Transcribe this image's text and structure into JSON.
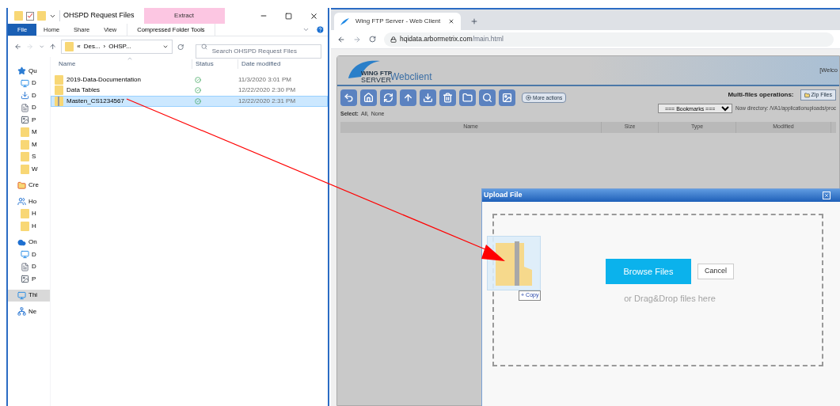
{
  "explorer": {
    "title": "OHSPD Request Files",
    "contextual_label": "Extract",
    "ribbon_tabs": [
      {
        "label": "File",
        "kind": "file",
        "selected": false
      },
      {
        "label": "Home",
        "kind": "tab",
        "selected": false
      },
      {
        "label": "Share",
        "kind": "tab",
        "selected": false
      },
      {
        "label": "View",
        "kind": "tab",
        "selected": false
      },
      {
        "label": "Compressed Folder Tools",
        "kind": "contextual",
        "selected": false
      }
    ],
    "breadcrumb": [
      "«",
      "Des...",
      "›",
      "OHSP..."
    ],
    "search": {
      "placeholder": "Search OHSPD Request Files"
    },
    "columns": [
      "Name",
      "Status",
      "Date modified"
    ],
    "rows": [
      {
        "name": "2019-Data-Documentation",
        "kind": "folder",
        "modified": "11/3/2020 3:01 PM",
        "selected": false
      },
      {
        "name": "Data Tables",
        "kind": "folder",
        "modified": "12/22/2020 2:30 PM",
        "selected": false
      },
      {
        "name": "Masten_CS1234567",
        "kind": "zip",
        "modified": "12/22/2020 2:31 PM",
        "selected": true
      }
    ],
    "nav": [
      {
        "label": "Qu",
        "kind": "star",
        "selected": false
      },
      {
        "label": "D",
        "kind": "desktop",
        "selected": false
      },
      {
        "label": "D",
        "kind": "download",
        "selected": false
      },
      {
        "label": "D",
        "kind": "doc",
        "selected": false
      },
      {
        "label": "P",
        "kind": "pictures",
        "selected": false
      },
      {
        "label": "M",
        "kind": "folder",
        "selected": false
      },
      {
        "label": "M",
        "kind": "folder",
        "selected": false
      },
      {
        "label": "S",
        "kind": "folder",
        "selected": false
      },
      {
        "label": "W",
        "kind": "folder",
        "selected": false
      },
      {
        "label": "Cre",
        "kind": "cloud-folder",
        "selected": false
      },
      {
        "label": "Ho",
        "kind": "homegroup",
        "selected": false
      },
      {
        "label": "H",
        "kind": "folder",
        "selected": false
      },
      {
        "label": "H",
        "kind": "folder",
        "selected": false
      },
      {
        "label": "On",
        "kind": "cloud",
        "selected": false
      },
      {
        "label": "D",
        "kind": "desktop",
        "selected": false
      },
      {
        "label": "D",
        "kind": "doc",
        "selected": false
      },
      {
        "label": "P",
        "kind": "pictures",
        "selected": false
      },
      {
        "label": "Thi",
        "kind": "pc",
        "selected": true
      },
      {
        "label": "Ne",
        "kind": "network",
        "selected": false
      }
    ]
  },
  "browser": {
    "tab_title": "Wing FTP Server - Web Client",
    "url_host": "hqidata.arbormetrix.com",
    "url_path": "/main.html",
    "webclient": {
      "logo_small": "WING FTP",
      "logo_big": "SERVER",
      "app_name": "Webclient",
      "welcome": "[Welco",
      "more_actions": "More actions",
      "multi_label": "Multi-files operations:",
      "zip_button": "Zip Files",
      "select_label": "Select:",
      "select_links": [
        "All,",
        "None"
      ],
      "bookmarks": "=== Bookmarks ===",
      "now_directory": "Now directory: /VA1/applicationuploads/proc",
      "columns": [
        "Name",
        "Size",
        "Type",
        "Modified"
      ]
    },
    "dialog": {
      "title": "Upload File",
      "browse_button": "Browse Files",
      "cancel_button": "Cancel",
      "hint": "or Drag&Drop files here"
    }
  },
  "drag": {
    "plus": "+",
    "label": "Copy"
  }
}
